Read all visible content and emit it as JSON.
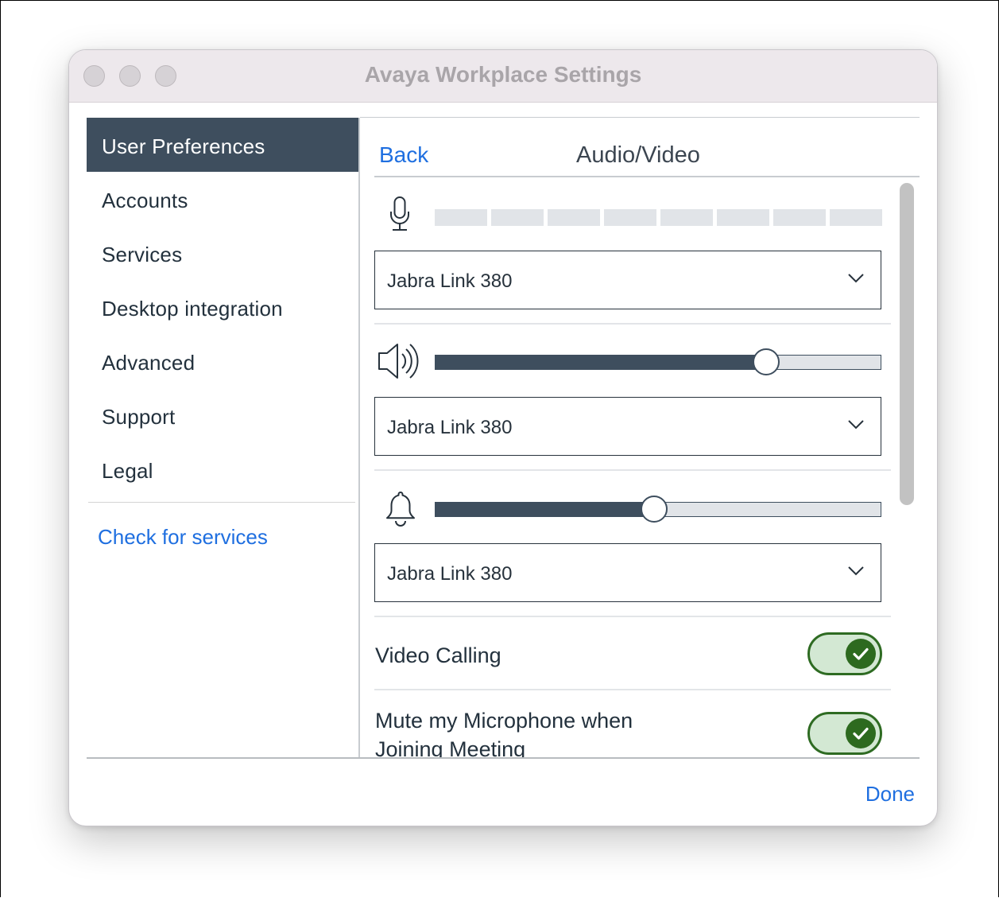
{
  "window": {
    "title": "Avaya Workplace Settings"
  },
  "sidebar": {
    "items": [
      {
        "label": "User Preferences",
        "active": true
      },
      {
        "label": "Accounts"
      },
      {
        "label": "Services"
      },
      {
        "label": "Desktop integration"
      },
      {
        "label": "Advanced"
      },
      {
        "label": "Support"
      },
      {
        "label": "Legal"
      }
    ],
    "check_link": "Check for services"
  },
  "panel": {
    "back_label": "Back",
    "title": "Audio/Video",
    "microphone": {
      "icon": "microphone-icon",
      "level_segments": 8,
      "level_filled": 0,
      "device": "Jabra Link 380"
    },
    "speaker": {
      "icon": "speaker-icon",
      "volume_fraction": 0.74,
      "device": "Jabra Link 380"
    },
    "ringer": {
      "icon": "bell-icon",
      "volume_fraction": 0.49,
      "device": "Jabra Link 380"
    },
    "toggles": [
      {
        "label": "Video Calling",
        "on": true
      },
      {
        "label": "Mute my Microphone when Joining Meeting",
        "on": true
      }
    ]
  },
  "footer": {
    "done_label": "Done"
  },
  "colors": {
    "accent": "#1f6fe0",
    "sidebar_active": "#3e4e5e",
    "toggle_on": "#2d6a1f"
  }
}
